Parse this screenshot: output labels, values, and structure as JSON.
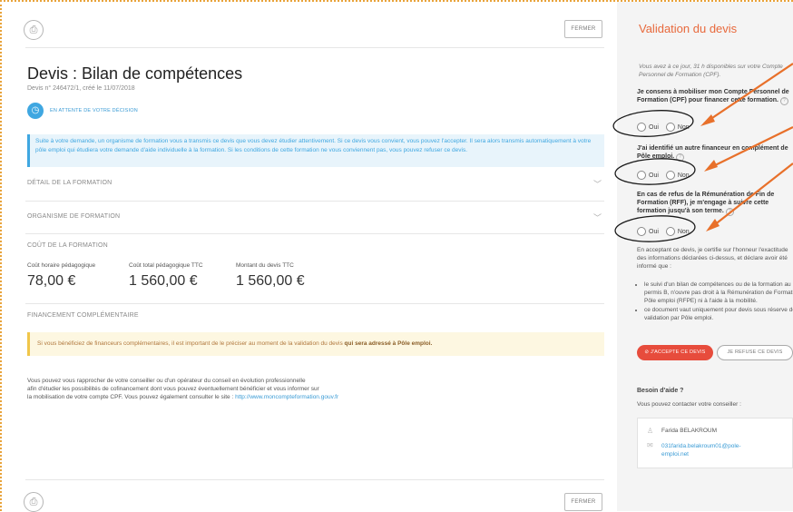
{
  "main": {
    "close_label": "FERMER",
    "title": "Devis : Bilan de compétences",
    "subtitle": "Devis n° 246472/1, créé le 11/07/2018",
    "status": "EN ATTENTE DE VOTRE DÉCISION",
    "info_text": "Suite à votre demande, un organisme de formation vous a transmis ce devis que vous devez étudier attentivement. Si ce devis vous convient, vous pouvez l'accepter. Il sera alors transmis automatiquement à votre pôle emploi qui étudiera votre demande d'aide individuelle à la formation. Si les conditions de cette formation ne vous conviennent pas, vous pouvez refuser ce devis.",
    "sections": {
      "detail": "DÉTAIL DE LA FORMATION",
      "organisme": "ORGANISME DE FORMATION",
      "cout": "COÛT DE LA FORMATION",
      "financement": "FINANCEMENT COMPLÉMENTAIRE"
    },
    "costs": [
      {
        "label": "Coût horaire pédagogique",
        "value": "78,00 €"
      },
      {
        "label": "Coût total pédagogique TTC",
        "value": "1 560,00 €"
      },
      {
        "label": "Montant du devis TTC",
        "value": "1 560,00 €"
      }
    ],
    "warning_text": "Si vous bénéficiez de financeurs complémentaires, il est important de le préciser au moment de la validation du devis ",
    "warning_bold": "qui sera adressé à Pôle emploi.",
    "para_lines": [
      "Vous pouvez vous rapprocher de votre conseiller ou d'un opérateur du conseil en évolution professionnelle",
      "afin d'étudier les possibilités de cofinancement dont vous pouvez éventuellement bénéficier et vous informer sur",
      "la mobilisation de votre compte CPF. Vous pouvez également consulter le site : "
    ],
    "link": "http://www.moncompteformation.gouv.fr"
  },
  "sidebar": {
    "title": "Validation du devis",
    "intro": "Vous avez à ce jour, 31 h disponibles sur votre Compte Personnel de Formation (CPF).",
    "q1": "Je consens à mobiliser mon Compte Personnel de Formation (CPF) pour financer cette formation.",
    "q2": "J'ai identifié un autre financeur en complément de Pôle emploi.",
    "q3": "En cas de refus de la Rémunération de Fin de Formation (RFF), je m'engage à suivre cette formation jusqu'à son terme.",
    "oui": "Oui",
    "non": "Non",
    "certify": "En acceptant ce devis, je certifie sur l'honneur l'exactitude des informations déclarées ci-dessus, et déclare avoir été informé que :",
    "bullets": [
      "le suivi d'un bilan de compétences ou de la formation au permis B, n'ouvre pas droit à la Rémunération de Formation Pôle emploi (RFPE) ni à l'aide à la mobilité.",
      "ce document vaut uniquement pour devis sous réserve de validation par Pôle emploi."
    ],
    "accept": "J'ACCEPTE CE DEVIS",
    "refuse": "JE REFUSE CE DEVIS",
    "help_title": "Besoin d'aide ?",
    "help_sub": "Vous pouvez contacter votre conseiller :",
    "contact_name": "Farida BELAKROUM",
    "contact_email": "031farida.belakroum01@pole-emploi.net"
  },
  "colors": {
    "accent_blue": "#3fa7e1",
    "accent_orange": "#e8693c",
    "accept_red": "#e74c3c",
    "warning_bg": "#fdf7e1",
    "annotation": "#e8702a"
  }
}
